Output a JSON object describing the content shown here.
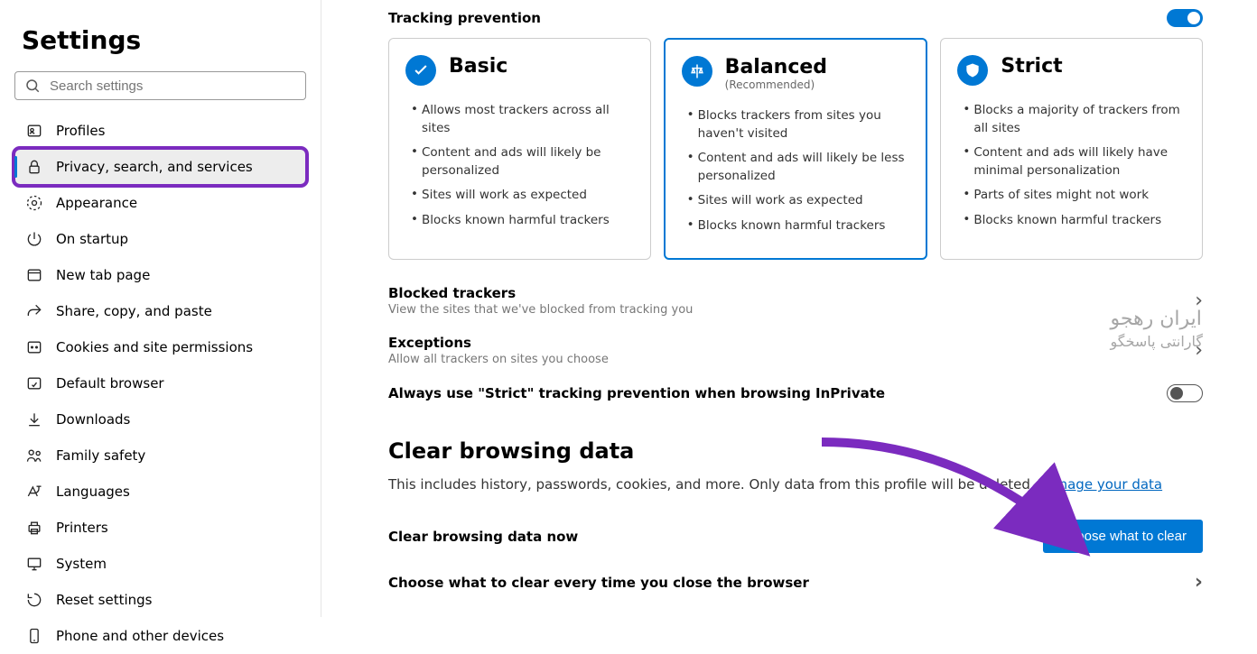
{
  "sidebar": {
    "title": "Settings",
    "search_placeholder": "Search settings",
    "items": [
      {
        "label": "Profiles",
        "icon": "profile-icon"
      },
      {
        "label": "Privacy, search, and services",
        "icon": "lock-icon"
      },
      {
        "label": "Appearance",
        "icon": "appearance-icon"
      },
      {
        "label": "On startup",
        "icon": "power-icon"
      },
      {
        "label": "New tab page",
        "icon": "newtab-icon"
      },
      {
        "label": "Share, copy, and paste",
        "icon": "share-icon"
      },
      {
        "label": "Cookies and site permissions",
        "icon": "cookies-icon"
      },
      {
        "label": "Default browser",
        "icon": "default-icon"
      },
      {
        "label": "Downloads",
        "icon": "download-icon"
      },
      {
        "label": "Family safety",
        "icon": "family-icon"
      },
      {
        "label": "Languages",
        "icon": "languages-icon"
      },
      {
        "label": "Printers",
        "icon": "printers-icon"
      },
      {
        "label": "System",
        "icon": "system-icon"
      },
      {
        "label": "Reset settings",
        "icon": "reset-icon"
      },
      {
        "label": "Phone and other devices",
        "icon": "phone-icon"
      }
    ]
  },
  "tracking": {
    "title": "Tracking prevention",
    "enabled": true,
    "cards": [
      {
        "title": "Basic",
        "sub": "",
        "bullets": [
          "Allows most trackers across all sites",
          "Content and ads will likely be personalized",
          "Sites will work as expected",
          "Blocks known harmful trackers"
        ]
      },
      {
        "title": "Balanced",
        "sub": "(Recommended)",
        "bullets": [
          "Blocks trackers from sites you haven't visited",
          "Content and ads will likely be less personalized",
          "Sites will work as expected",
          "Blocks known harmful trackers"
        ]
      },
      {
        "title": "Strict",
        "sub": "",
        "bullets": [
          "Blocks a majority of trackers from all sites",
          "Content and ads will likely have minimal personalization",
          "Parts of sites might not work",
          "Blocks known harmful trackers"
        ]
      }
    ],
    "blocked": {
      "title": "Blocked trackers",
      "sub": "View the sites that we've blocked from tracking you"
    },
    "exceptions": {
      "title": "Exceptions",
      "sub": "Allow all trackers on sites you choose"
    },
    "inprivate": {
      "title": "Always use \"Strict\" tracking prevention when browsing InPrivate"
    }
  },
  "clear": {
    "heading": "Clear browsing data",
    "desc": "This includes history, passwords, cookies, and more. Only data from this profile will be deleted. ",
    "link": "Manage your data",
    "row1": "Clear browsing data now",
    "btn": "Choose what to clear",
    "row2": "Choose what to clear every time you close the browser"
  },
  "watermark": {
    "l1": "ایران رهجو",
    "l2": "گارانتی پاسخگو"
  }
}
